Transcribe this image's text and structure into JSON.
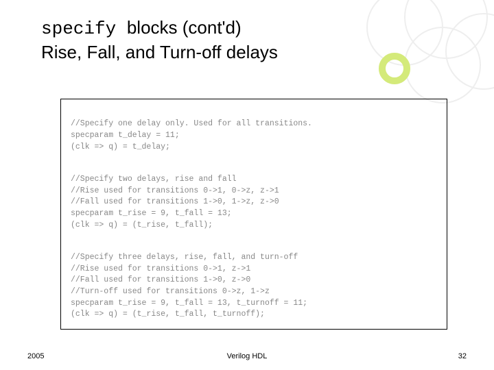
{
  "title": {
    "mono": "specify ",
    "rest1": "blocks (cont'd)",
    "line2": "Rise, Fall, and Turn-off delays"
  },
  "code": {
    "block1": {
      "l1": "//Specify one delay only. Used for all transitions.",
      "l2": "specparam t_delay = 11;",
      "l3": "(clk => q) = t_delay;"
    },
    "block2": {
      "l1": "//Specify two delays, rise and fall",
      "l2": "//Rise used for transitions 0->1, 0->z, z->1",
      "l3": "//Fall used for transitions 1->0, 1->z, z->0",
      "l4": "specparam t_rise = 9, t_fall = 13;",
      "l5": "(clk => q) = (t_rise, t_fall);"
    },
    "block3": {
      "l1": "//Specify three delays, rise, fall, and turn-off",
      "l2": "//Rise used for transitions 0->1, z->1",
      "l3": "//Fall used for transitions 1->0, z->0",
      "l4": "//Turn-off used for transitions 0->z, 1->z",
      "l5": "specparam t_rise = 9, t_fall = 13, t_turnoff = 11;",
      "l6": "(clk => q) = (t_rise, t_fall, t_turnoff);"
    }
  },
  "footer": {
    "year": "2005",
    "center": "Verilog HDL",
    "page": "32"
  }
}
